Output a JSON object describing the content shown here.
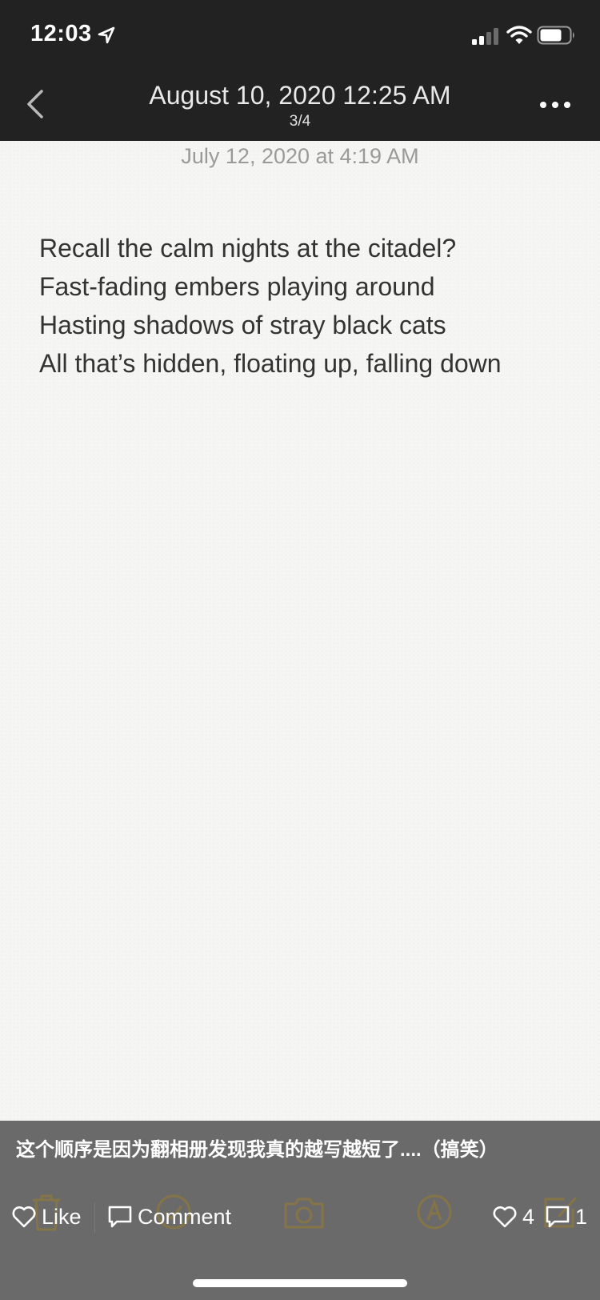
{
  "status_bar": {
    "time": "12:03",
    "icons": [
      "location-arrow-icon",
      "signal-icon",
      "wifi-icon",
      "battery-icon"
    ]
  },
  "nav": {
    "title": "August 10, 2020 12:25 AM",
    "subtitle": "3/4",
    "back_icon": "chevron-left-icon",
    "more_icon": "more-horizontal-icon"
  },
  "note": {
    "date": "July 12, 2020 at 4:19 AM",
    "lines": [
      "Recall the calm nights at the citadel?",
      "Fast-fading embers playing around",
      "Hasting shadows of stray black cats",
      "All that’s hidden, floating up, falling down"
    ]
  },
  "overlay": {
    "caption": "这个顺序是因为翻相册发现我真的越写越短了....（搞笑）",
    "background_toolbar_icons": [
      "trash-icon",
      "checklist-icon",
      "camera-icon",
      "markup-icon",
      "compose-icon"
    ],
    "like_label": "Like",
    "comment_label": "Comment",
    "likes_count": "4",
    "comments_count": "1"
  },
  "colors": {
    "header_background": "#222222",
    "paper": "#f5f5f4",
    "note_text": "#333333",
    "date_text": "#9a9a9a",
    "overlay": "#6a6a6a",
    "ghost_icon": "#b08a1e"
  }
}
